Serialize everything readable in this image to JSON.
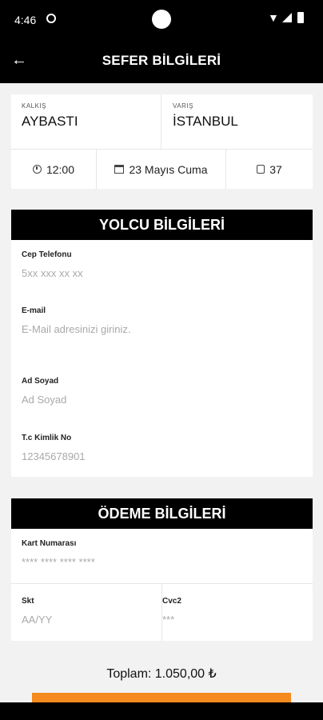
{
  "status_bar": {
    "time": "4:46"
  },
  "header": {
    "title": "SEFER BİLGİLERİ"
  },
  "trip": {
    "departure_label": "KALKIŞ",
    "departure_city": "AYBASTI",
    "arrival_label": "VARIŞ",
    "arrival_city": "İSTANBUL",
    "time": "12:00",
    "date": "23 Mayıs Cuma",
    "seat": "37"
  },
  "passenger": {
    "title": "YOLCU BİLGİLERİ",
    "fields": [
      {
        "label": "Cep Telefonu",
        "placeholder": "5xx xxx xx xx"
      },
      {
        "label": "E-mail",
        "placeholder": "E-Mail adresinizi giriniz."
      },
      {
        "label": "Ad Soyad",
        "placeholder": "Ad Soyad"
      },
      {
        "label": "T.c Kimlik No",
        "placeholder": "12345678901"
      }
    ]
  },
  "payment": {
    "title": "ÖDEME BİLGİLERİ",
    "card_number": {
      "label": "Kart Numarası",
      "placeholder": "**** **** **** ****"
    },
    "expiry": {
      "label": "Skt",
      "placeholder": "AA/YY"
    },
    "cvc": {
      "label": "Cvc2",
      "placeholder": "***"
    }
  },
  "total": {
    "text": "Toplam: 1.050,00 ₺"
  },
  "colors": {
    "accent": "#f58a1f",
    "header": "#000000",
    "background": "#f2f2f2"
  },
  "icons": {
    "back": "arrow-left-icon",
    "time": "clock-icon",
    "date": "calendar-icon",
    "seat": "seat-icon"
  }
}
